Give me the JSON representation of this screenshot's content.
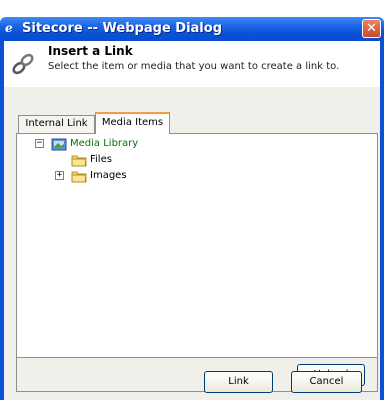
{
  "window": {
    "title": "Sitecore -- Webpage Dialog",
    "close_glyph": "✕",
    "browser_icon": "ie-icon"
  },
  "header": {
    "title": "Insert a Link",
    "subtitle": "Select the item or media that you want to create a link to.",
    "icon": "chain-link-icon"
  },
  "tabs": [
    {
      "label": "Internal Link",
      "active": false
    },
    {
      "label": "Media Items",
      "active": true
    }
  ],
  "tree": {
    "root": {
      "label": "Media Library",
      "expander": "−",
      "icon": "media-library-icon",
      "selected": true
    },
    "children": [
      {
        "label": "Files",
        "expander": "",
        "icon": "folder-icon"
      },
      {
        "label": "Images",
        "expander": "+",
        "icon": "folder-icon"
      }
    ]
  },
  "buttons": {
    "upload": "Upload",
    "link": "Link",
    "cancel": "Cancel"
  },
  "colors": {
    "titlebar": "#0a52d4",
    "close_button": "#c94a26",
    "active_tab_accent": "#f0a040",
    "selected_text": "#0c6e0c",
    "dialog_background": "#f0efe9"
  }
}
